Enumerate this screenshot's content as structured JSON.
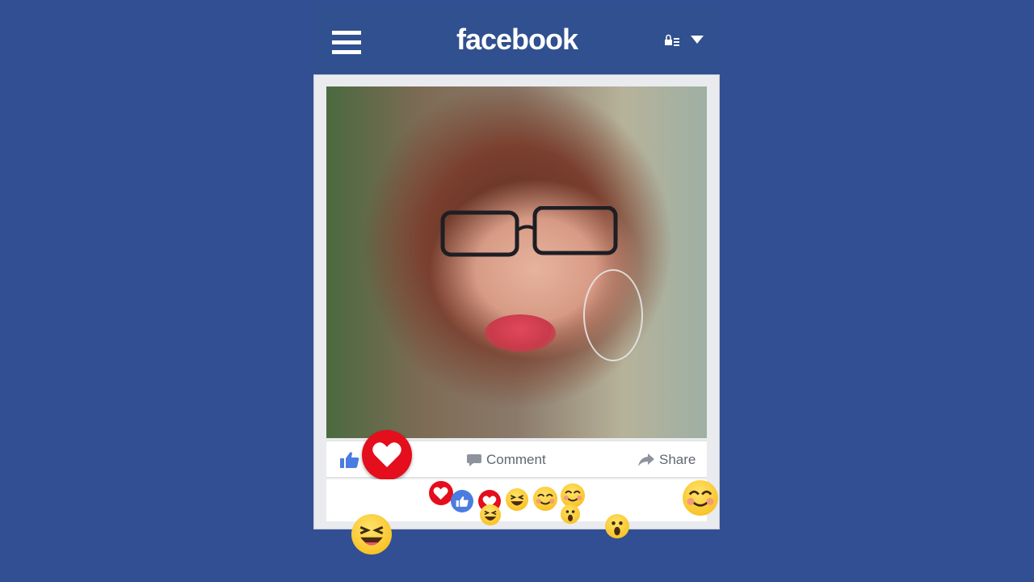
{
  "app": {
    "logo_text": "facebook"
  },
  "header": {
    "menu_icon": "hamburger-icon",
    "privacy_icon": "privacy-shortcuts-icon",
    "dropdown_icon": "caret-down-icon"
  },
  "post": {
    "photo": "portrait-photo-woman-glasses",
    "actions": {
      "like_icon": "like-thumb-icon",
      "love_icon": "love-heart-icon",
      "comment_label": "Comment",
      "share_label": "Share"
    }
  },
  "reactions": [
    "love",
    "like",
    "love",
    "haha",
    "haha",
    "smile",
    "smile",
    "wow",
    "wow",
    "haha",
    "smile"
  ],
  "colors": {
    "background": "#324f94",
    "header": "#30508f",
    "love_red": "#e40e1c",
    "like_blue": "#4a7ce2",
    "text_gray": "#606770"
  }
}
